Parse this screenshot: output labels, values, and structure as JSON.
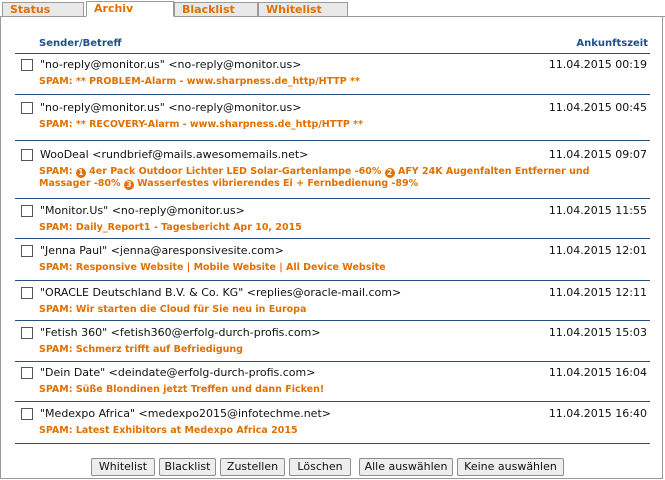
{
  "tabs": [
    {
      "label": "Status"
    },
    {
      "label": "Archiv",
      "active": true
    },
    {
      "label": "Blacklist"
    },
    {
      "label": "Whitelist"
    }
  ],
  "table": {
    "col_sender": "Sender/Betreff",
    "col_time": "Ankunftszeit"
  },
  "messages": [
    {
      "sender": "\"no-reply@monitor.us\" <no-reply@monitor.us>",
      "time": "11.04.2015 00:19",
      "subject": "SPAM: ** PROBLEM-Alarm - www.sharpness.de_http/HTTP **"
    },
    {
      "sender": "\"no-reply@monitor.us\" <no-reply@monitor.us>",
      "time": "11.04.2015 00:45",
      "subject": "SPAM: ** RECOVERY-Alarm - www.sharpness.de_http/HTTP **"
    },
    {
      "sender": "WooDeal <rundbrief@mails.awesomemails.net>",
      "time": "11.04.2015 09:07",
      "subject_parts": [
        "SPAM:",
        "1",
        "4er Pack Outdoor Lichter LED Solar-Gartenlampe -60%",
        "2",
        "AFY 24K Augenfalten Entferner und Massager -80%",
        "3",
        "Wasserfestes vibrierendes Ei + Fernbedienung -89%"
      ]
    },
    {
      "sender": "\"Monitor.Us\" <no-reply@monitor.us>",
      "time": "11.04.2015 11:55",
      "subject": "SPAM: Daily_Report1 - Tagesbericht Apr 10, 2015"
    },
    {
      "sender": "\"Jenna Paul\" <jenna@aresponsivesite.com>",
      "time": "11.04.2015 12:01",
      "subject": "SPAM: Responsive Website | Mobile Website | All Device Website"
    },
    {
      "sender": "\"ORACLE Deutschland B.V. & Co. KG\" <replies@oracle-mail.com>",
      "time": "11.04.2015 12:11",
      "subject": "SPAM: Wir starten die Cloud für Sie neu in Europa"
    },
    {
      "sender": "\"Fetish 360\" <fetish360@erfolg-durch-profis.com>",
      "time": "11.04.2015 15:03",
      "subject": "SPAM: Schmerz trifft auf Befriedigung"
    },
    {
      "sender": "\"Dein Date\" <deindate@erfolg-durch-profis.com>",
      "time": "11.04.2015 16:04",
      "subject": "SPAM: Süße Blondinen jetzt Treffen und dann Ficken!"
    },
    {
      "sender": "\"Medexpo Africa\" <medexpo2015@infotechme.net>",
      "time": "11.04.2015 16:40",
      "subject": "SPAM: Latest Exhibitors at Medexpo Africa 2015"
    }
  ],
  "buttons": {
    "whitelist": "Whitelist",
    "blacklist": "Blacklist",
    "zustellen": "Zustellen",
    "loeschen": "Löschen",
    "alle": "Alle auswählen",
    "keine": "Keine auswählen"
  },
  "colors": {
    "accent": "#e07000",
    "header_blue": "#1f4e8c",
    "rule": "#2a4f7f"
  }
}
